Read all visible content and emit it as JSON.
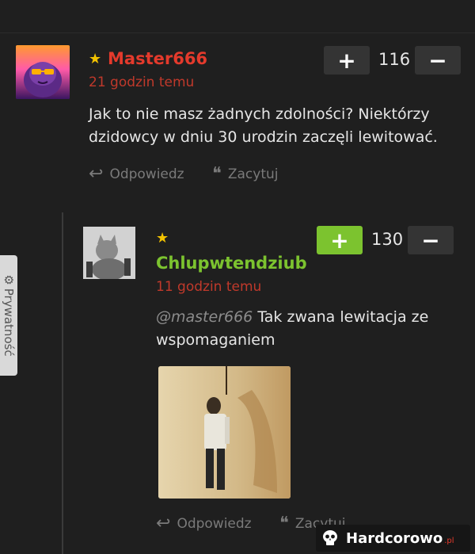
{
  "comment1": {
    "username": "Master666",
    "time": "21 godzin temu",
    "text": "Jak to nie masz żadnych zdolności? Niektórzy dzidowcy w dniu 30 urodzin zaczęli lewitować.",
    "votes": "116",
    "plus": "+",
    "minus": "−",
    "reply_label": "Odpowiedz",
    "quote_label": "Zacytuj"
  },
  "comment2": {
    "username": "Chlupwtendziub",
    "time": "11 godzin temu",
    "mention": "@master666",
    "text": " Tak zwana lewitacja ze wspomaganiem",
    "votes": "130",
    "plus": "+",
    "minus": "−",
    "reply_label": "Odpowiedz",
    "quote_label": "Zacytuj"
  },
  "privacy": {
    "label": "Prywatność"
  },
  "watermark": {
    "text": "Hardcorowo",
    "suffix": ".pl"
  },
  "colors": {
    "accent_red": "#e43a2c",
    "accent_green": "#7cc32f",
    "star": "#f2c200"
  }
}
